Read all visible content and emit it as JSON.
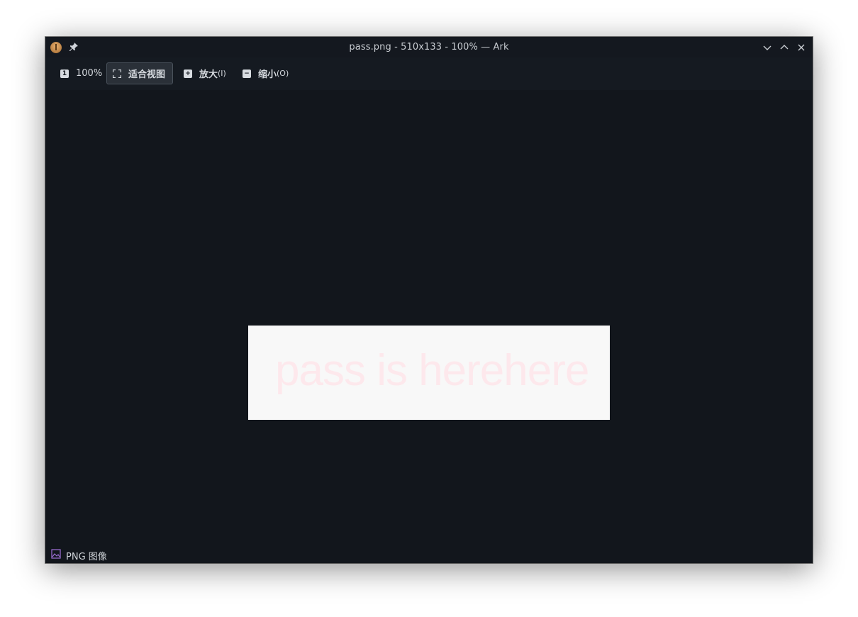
{
  "window": {
    "title": "pass.png - 510x133 - 100% — Ark",
    "icons": [
      "app-icon",
      "pin-icon",
      "minimize-icon",
      "maximize-icon",
      "close-icon"
    ]
  },
  "toolbar": {
    "actual_size": {
      "icon": "1",
      "label": "100%"
    },
    "fit_view": {
      "label": "适合视图"
    },
    "zoom_in": {
      "label": "放大",
      "shortcut": "(I)"
    },
    "zoom_out": {
      "label": "缩小",
      "shortcut": "(O)"
    }
  },
  "preview": {
    "image_text": "pass is herehere"
  },
  "status": {
    "file_type": "PNG 图像"
  },
  "colors": {
    "background": "#12161c",
    "image_bg": "#f8f8f8",
    "image_text": "#fde8ec"
  }
}
